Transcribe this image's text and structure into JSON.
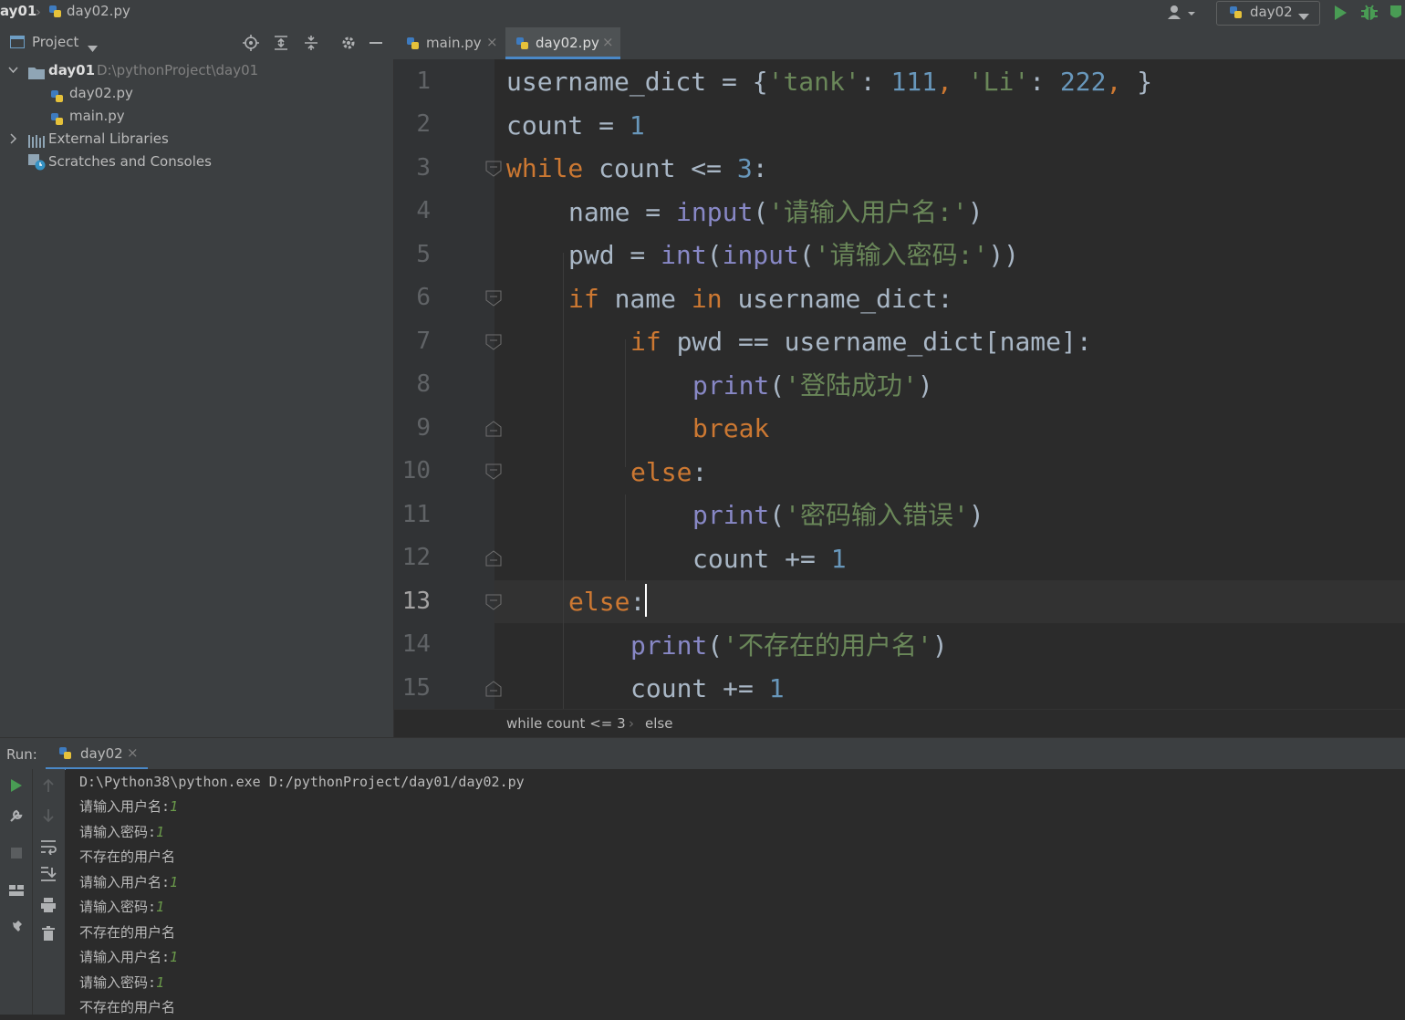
{
  "navbar": {
    "crumb_project": "ay01",
    "crumb_file": "day02.py",
    "run_config": "day02"
  },
  "project_panel": {
    "title": "Project",
    "tree": [
      {
        "label": "day01",
        "path": "D:\\pythonProject\\day01"
      },
      {
        "label": "day02.py"
      },
      {
        "label": "main.py"
      },
      {
        "label": "External Libraries"
      },
      {
        "label": "Scratches and Consoles"
      }
    ]
  },
  "tabs": [
    {
      "label": "main.py"
    },
    {
      "label": "day02.py"
    }
  ],
  "editor": {
    "line_numbers": [
      "1",
      "2",
      "3",
      "4",
      "5",
      "6",
      "7",
      "8",
      "9",
      "10",
      "11",
      "12",
      "13",
      "14",
      "15"
    ],
    "current_line": "13",
    "breadcrumb": [
      "while count <= 3",
      "else"
    ]
  },
  "code": {
    "l1": {
      "var": "username_dict",
      "op": " = {",
      "s1": "'tank'",
      "c1": ": ",
      "n1": "111",
      "sep1": ", ",
      "s2": "'Li'",
      "c2": ": ",
      "n2": "222",
      "sep2": ", ",
      "end": "}"
    },
    "l2": {
      "var": "count",
      "op": " = ",
      "n": "1"
    },
    "l3": {
      "kw": "while",
      "rest": " count <= ",
      "n": "3",
      "end": ":"
    },
    "l4": {
      "var": "name",
      "op": " = ",
      "fn": "input",
      "p1": "(",
      "s": "'请输入用户名:'",
      "p2": ")"
    },
    "l5": {
      "var": "pwd",
      "op": " = ",
      "fn1": "int",
      "p1": "(",
      "fn2": "input",
      "p2": "(",
      "s": "'请输入密码:'",
      "p3": "))"
    },
    "l6": {
      "kw1": "if",
      "t1": " name ",
      "kw2": "in",
      "t2": " username_dict:"
    },
    "l7": {
      "kw": "if",
      "rest": " pwd == username_dict[name]:"
    },
    "l8": {
      "fn": "print",
      "p1": "(",
      "s": "'登陆成功'",
      "p2": ")"
    },
    "l9": {
      "kw": "break"
    },
    "l10": {
      "kw": "else",
      "end": ":"
    },
    "l11": {
      "fn": "print",
      "p1": "(",
      "s": "'密码输入错误'",
      "p2": ")"
    },
    "l12": {
      "rest": "count += ",
      "n": "1"
    },
    "l13": {
      "kw": "else",
      "end": ":"
    },
    "l14": {
      "fn": "print",
      "p1": "(",
      "s": "'不存在的用户名'",
      "p2": ")"
    },
    "l15": {
      "rest": "count += ",
      "n": "1"
    }
  },
  "run": {
    "label": "Run:",
    "tab": "day02",
    "output": [
      {
        "text": "D:\\Python38\\python.exe D:/pythonProject/day01/day02.py",
        "input": ""
      },
      {
        "text": "请输入用户名:",
        "input": "1"
      },
      {
        "text": "请输入密码:",
        "input": "1"
      },
      {
        "text": "不存在的用户名",
        "input": ""
      },
      {
        "text": "请输入用户名:",
        "input": "1"
      },
      {
        "text": "请输入密码:",
        "input": "1"
      },
      {
        "text": "不存在的用户名",
        "input": ""
      },
      {
        "text": "请输入用户名:",
        "input": "1"
      },
      {
        "text": "请输入密码:",
        "input": "1"
      },
      {
        "text": "不存在的用户名",
        "input": ""
      }
    ]
  },
  "colors": {
    "keyword": "#cc7832",
    "string": "#6a8759",
    "number": "#6897bb",
    "builtin": "#8888c6",
    "run_green": "#499c54",
    "user_input": "#6a9a4a"
  }
}
